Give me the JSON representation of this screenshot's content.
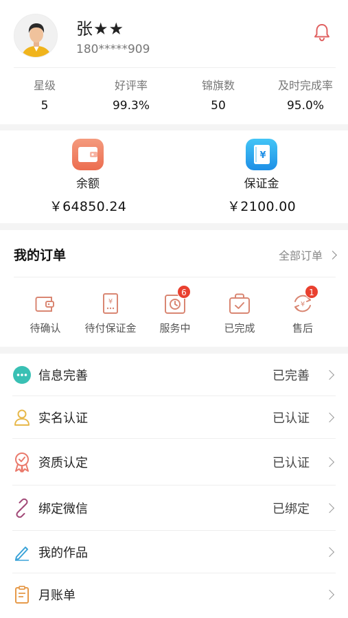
{
  "profile": {
    "name": "张★★",
    "phone": "180*****909",
    "avatar_icon": "person-avatar-icon",
    "notification_icon": "bell-icon"
  },
  "stats": [
    {
      "label": "星级",
      "value": "5"
    },
    {
      "label": "好评率",
      "value": "99.3%"
    },
    {
      "label": "锦旗数",
      "value": "50"
    },
    {
      "label": "及时完成率",
      "value": "95.0%"
    }
  ],
  "wallet": {
    "balance": {
      "label": "余额",
      "amount": "￥64850.24",
      "icon": "wallet-icon",
      "color": "#f08162"
    },
    "deposit": {
      "label": "保证金",
      "amount": "￥2100.00",
      "icon": "deposit-notebook-icon",
      "color": "#2fa9ec"
    }
  },
  "orders": {
    "title": "我的订单",
    "all_label": "全部订单",
    "items": [
      {
        "label": "待确认",
        "icon": "wallet-outline-icon",
        "badge": ""
      },
      {
        "label": "待付保证金",
        "icon": "yen-receipt-icon",
        "badge": ""
      },
      {
        "label": "服务中",
        "icon": "clock-icon",
        "badge": "6"
      },
      {
        "label": "已完成",
        "icon": "check-bag-icon",
        "badge": ""
      },
      {
        "label": "售后",
        "icon": "refund-cycle-icon",
        "badge": "1"
      }
    ]
  },
  "menu": [
    {
      "label": "信息完善",
      "status": "已完善",
      "icon": "info-dots-icon",
      "color": "#39c0b4"
    },
    {
      "label": "实名认证",
      "status": "已认证",
      "icon": "user-outline-icon",
      "color": "#e7b84a"
    },
    {
      "label": "资质认定",
      "status": "已认证",
      "icon": "award-ribbon-icon",
      "color": "#ea7a6c"
    },
    {
      "label": "绑定微信",
      "status": "已绑定",
      "icon": "link-icon",
      "color": "#a24a78"
    },
    {
      "label": "我的作品",
      "status": "",
      "icon": "pen-icon",
      "color": "#3aa3d8"
    },
    {
      "label": "月账单",
      "status": "",
      "icon": "bill-clipboard-icon",
      "color": "#e69a4a"
    }
  ],
  "colors": {
    "accent_orange": "#d98672",
    "badge_red": "#e9402f"
  }
}
